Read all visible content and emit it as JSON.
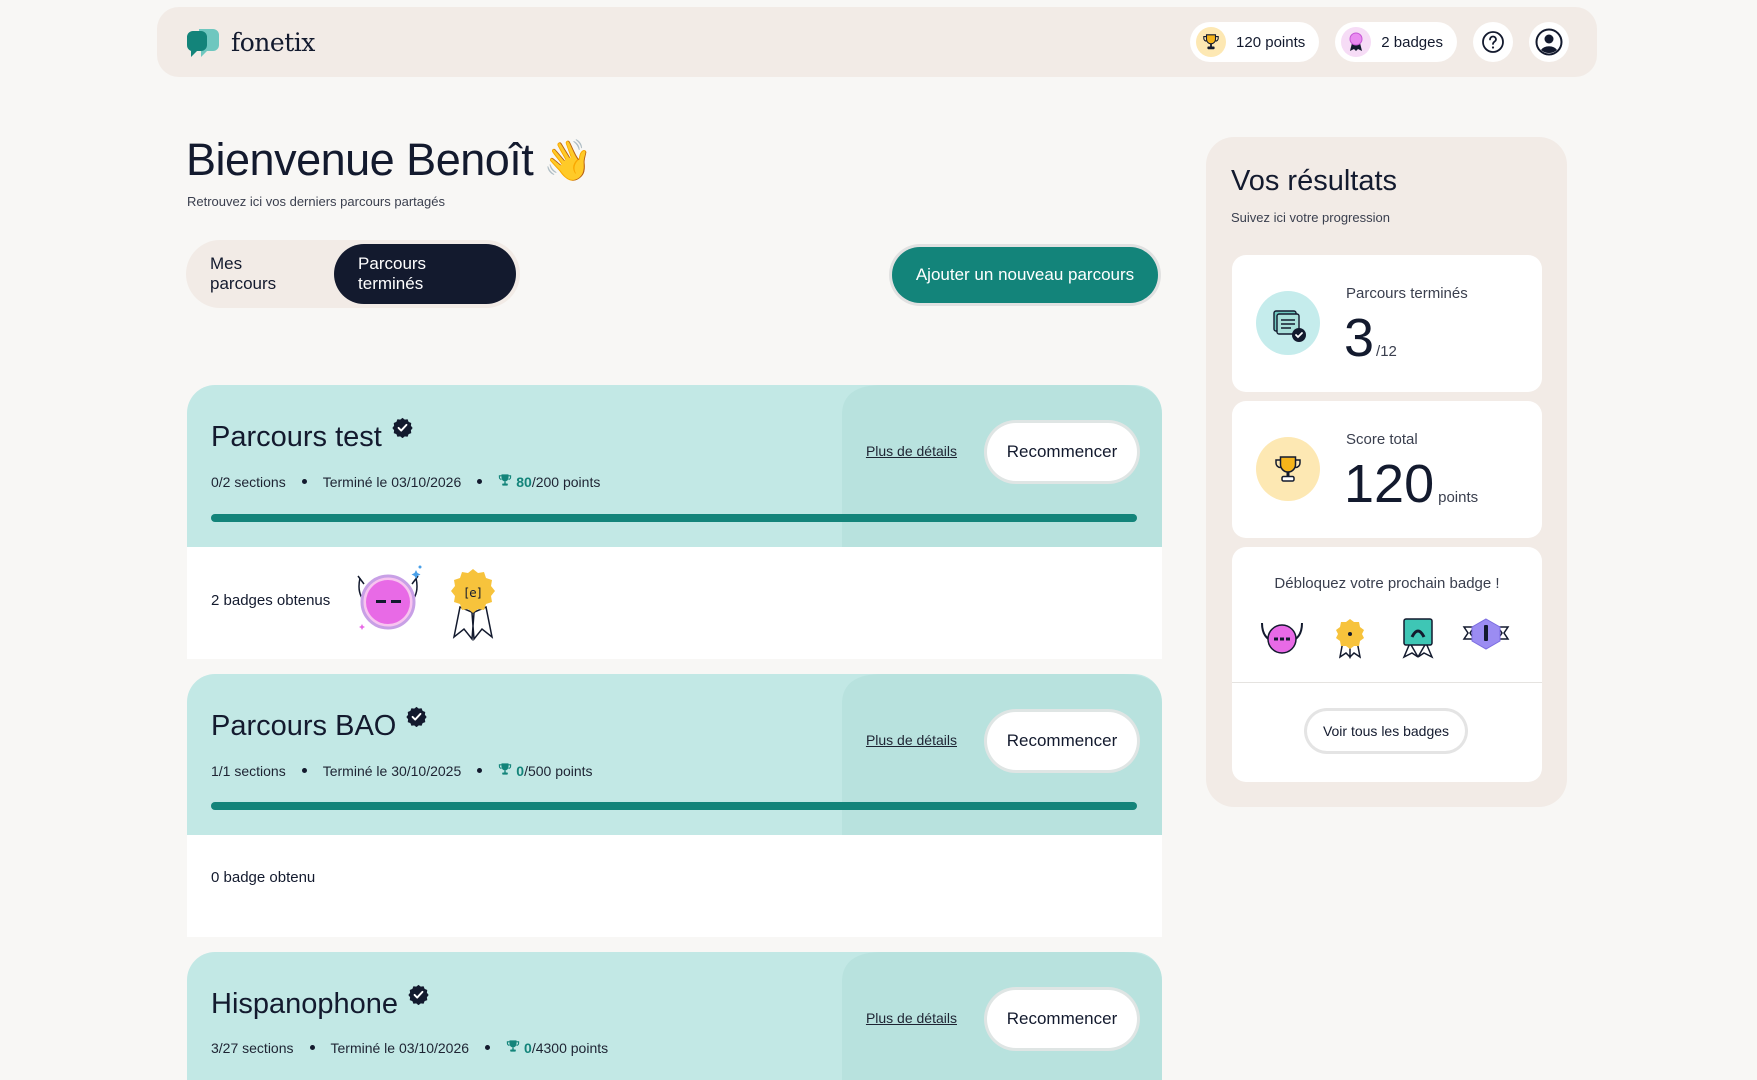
{
  "brand": {
    "name": "fonetix",
    "primary": "#13847a",
    "dark": "#131a2e"
  },
  "header": {
    "points_label": "120 points",
    "badges_label": "2 badges"
  },
  "welcome": {
    "title": "Bienvenue Benoît",
    "emoji": "👋",
    "subtitle": "Retrouvez ici vos derniers parcours partagés"
  },
  "tabs": [
    {
      "label": "Mes parcours",
      "active": false
    },
    {
      "label": "Parcours terminés",
      "active": true
    }
  ],
  "add_button": "Ajouter un nouveau parcours",
  "courses": [
    {
      "title": "Parcours test",
      "sections": "0/2 sections",
      "finished": "Terminé le 03/10/2026",
      "points_earned": "80",
      "points_total": "/200 points",
      "details": "Plus de détails",
      "restart": "Recommencer",
      "progress": 1.0,
      "badges_label": "2 badges obtenus"
    },
    {
      "title": "Parcours BAO",
      "sections": "1/1 sections",
      "finished": "Terminé le 30/10/2025",
      "points_earned": "0",
      "points_total": "/500 points",
      "details": "Plus de détails",
      "restart": "Recommencer",
      "progress": 1.0,
      "badges_label": "0 badge obtenu"
    },
    {
      "title": "Hispanophone",
      "sections": "3/27 sections",
      "finished": "Terminé le 03/10/2026",
      "points_earned": "0",
      "points_total": "/4300 points",
      "details": "Plus de détails",
      "restart": "Recommencer"
    }
  ],
  "badge_glyph": "[e]",
  "sidebar": {
    "title": "Vos résultats",
    "subtitle": "Suivez ici votre progression",
    "completed": {
      "label": "Parcours terminés",
      "value": "3",
      "total": "/12"
    },
    "score": {
      "label": "Score total",
      "value": "120",
      "unit": "points"
    },
    "next_badge": {
      "title": "Débloquez votre prochain badge !",
      "button": "Voir tous les badges"
    }
  }
}
